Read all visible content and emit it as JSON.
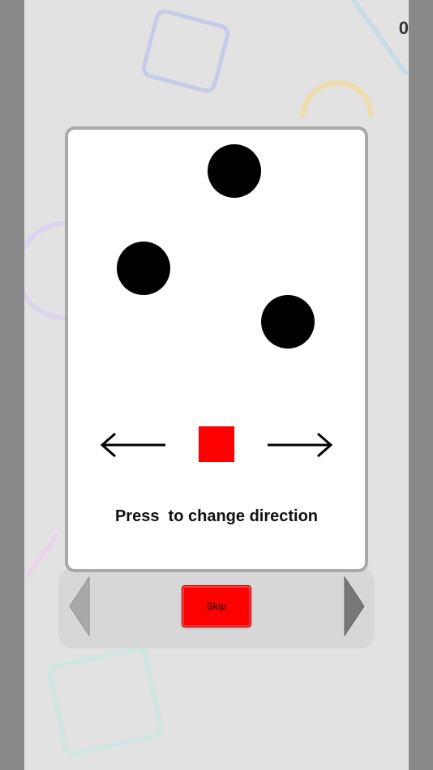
{
  "score": "0",
  "instruction": "Press  to change direction",
  "skip_label": "Skip",
  "colors": {
    "player": "#ff0000",
    "obstacle": "#000000",
    "card_border": "#a9a9a9",
    "skip_button": "#ff0000"
  },
  "icons": {
    "left_direction": "arrow-left-icon",
    "right_direction": "arrow-right-icon",
    "previous": "triangle-left-icon",
    "next": "triangle-right-icon"
  }
}
